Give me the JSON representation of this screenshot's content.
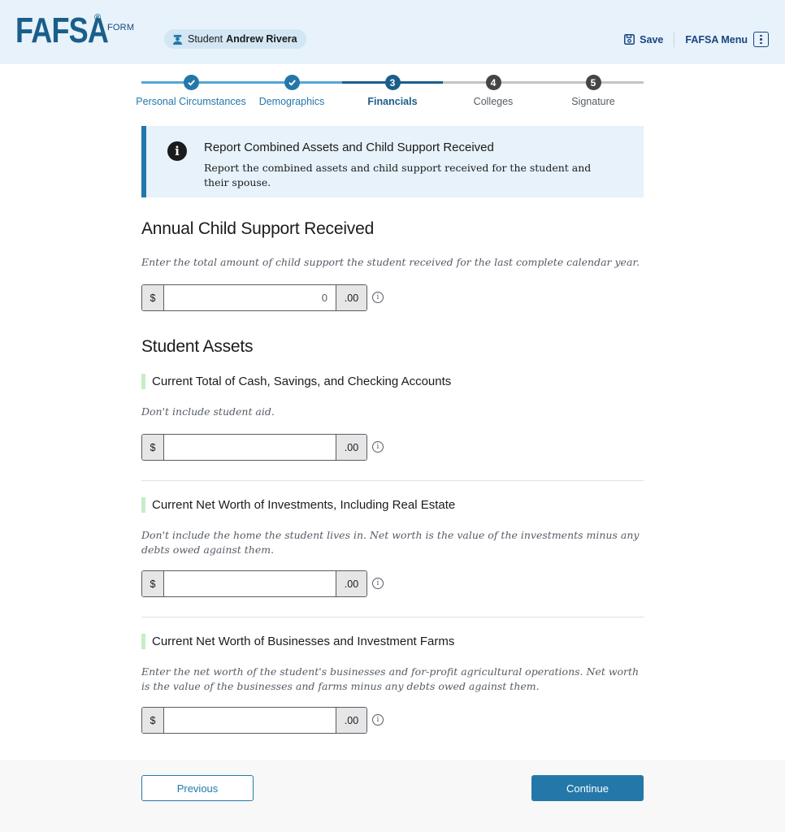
{
  "header": {
    "logo": "FAFSA",
    "logo_reg": "®",
    "logo_form": "FORM",
    "student_label": "Student",
    "student_name": "Andrew Rivera",
    "save_label": "Save",
    "menu_label": "FAFSA Menu"
  },
  "stepper": {
    "steps": [
      {
        "number": "1",
        "label": "Personal Circumstances",
        "status": "complete"
      },
      {
        "number": "2",
        "label": "Demographics",
        "status": "complete"
      },
      {
        "number": "3",
        "label": "Financials",
        "status": "current"
      },
      {
        "number": "4",
        "label": "Colleges",
        "status": "upcoming"
      },
      {
        "number": "5",
        "label": "Signature",
        "status": "upcoming"
      }
    ]
  },
  "alert": {
    "title": "Report Combined Assets and Child Support Received",
    "body": "Report the combined assets and child support received for the student and their spouse."
  },
  "child_support": {
    "heading": "Annual Child Support Received",
    "hint": "Enter the total amount of child support the student received for the last complete calendar year.",
    "prefix": "$",
    "value": "0",
    "suffix": ".00"
  },
  "assets": {
    "heading": "Student Assets",
    "questions": [
      {
        "label": "Current Total of Cash, Savings, and Checking Accounts",
        "hint": "Don't include student aid.",
        "prefix": "$",
        "value": "",
        "suffix": ".00"
      },
      {
        "label": "Current Net Worth of Investments, Including Real Estate",
        "hint": "Don't include the home the student lives in. Net worth is the value of the investments minus any debts owed against them.",
        "prefix": "$",
        "value": "",
        "suffix": ".00"
      },
      {
        "label": "Current Net Worth of Businesses and Investment Farms",
        "hint": "Enter the net worth of the student's businesses and for-profit agricultural operations. Net worth is the value of the businesses and farms minus any debts owed against them.",
        "prefix": "$",
        "value": "",
        "suffix": ".00"
      }
    ]
  },
  "footer": {
    "previous_label": "Previous",
    "continue_label": "Continue"
  },
  "colors": {
    "brand": "#1a5e8a",
    "primary": "#2378a9",
    "complete": "#2378a9",
    "current": "#1a5e8a",
    "upcoming": "#454545",
    "header_bg": "#e7f2fa",
    "label_accent": "#c6edc6"
  }
}
